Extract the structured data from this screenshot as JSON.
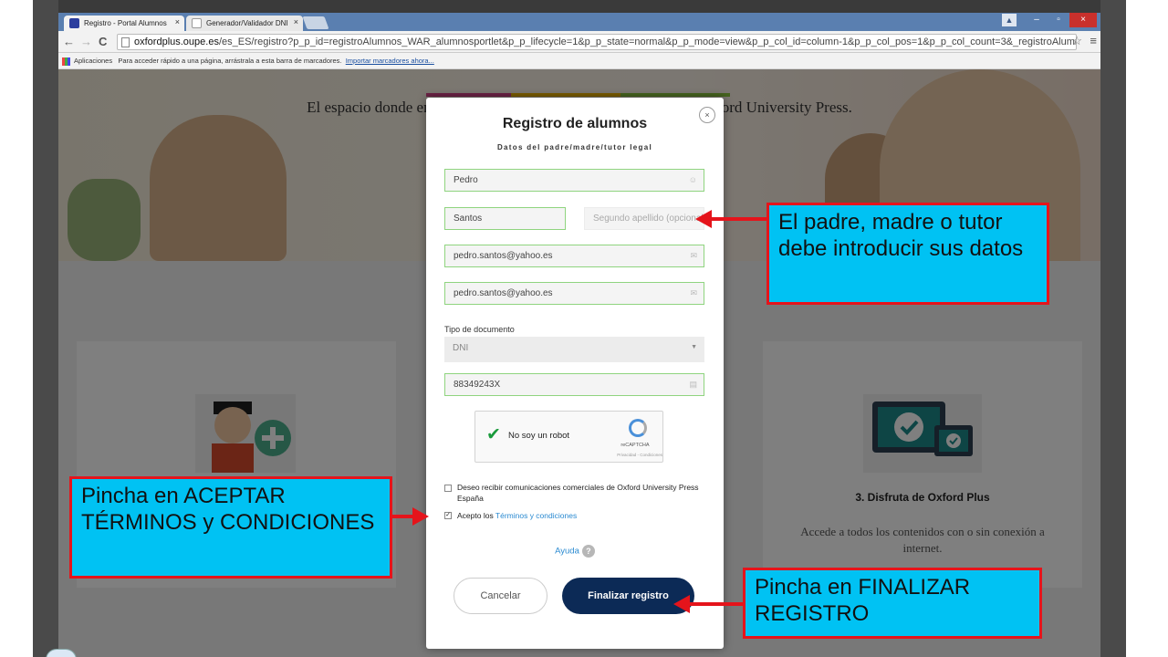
{
  "browser": {
    "tabs": [
      {
        "label": "Registro - Portal Alumnos",
        "close": "×"
      },
      {
        "label": "Generador/Validador DNI",
        "close": "×"
      }
    ],
    "window_controls": {
      "user": "▲",
      "minimize": "–",
      "maximize": "▫",
      "close": "×"
    },
    "nav": {
      "back": "←",
      "forward": "→",
      "reload": "C"
    },
    "url_host": "oxfordplus.oupe.es",
    "url_path": "/es_ES/registro?p_p_id=registroAlumnos_WAR_alumnosportlet&p_p_lifecycle=1&p_p_state=normal&p_p_mode=view&p_p_col_id=column-1&p_p_col_pos=1&p_p_col_count=3&_registroAlumnc",
    "star": "☆",
    "menu": "≡",
    "bookmarks": {
      "apps": "Aplicaciones",
      "hint": "Para acceder rápido a una página, arrástrala a esta barra de marcadores.",
      "import_link": "Importar marcadores ahora..."
    }
  },
  "page": {
    "hero_title": "El espacio donde encontrarás todos los contenidos digitales de Oxford University Press.",
    "card3_title": "3. Disfruta de Oxford Plus",
    "card3_desc": "Accede a todos los contenidos con o sin conexión a internet."
  },
  "modal": {
    "close": "×",
    "title": "Registro de alumnos",
    "subtitle": "Datos del padre/madre/tutor legal",
    "fields": {
      "first_name": "Pedro",
      "last_name": "Santos",
      "second_last_name_placeholder": "Segundo apellido (opcional)",
      "email": "pedro.santos@yahoo.es",
      "email_confirm": "pedro.santos@yahoo.es",
      "doc_type_label": "Tipo de documento",
      "doc_type": "DNI",
      "doc_number": "88349243X"
    },
    "captcha": {
      "check": "✔",
      "label": "No soy un robot",
      "brand": "reCAPTCHA",
      "terms": "Privacidad - Condiciones"
    },
    "consent": {
      "marketing": "Deseo recibir comunicaciones comerciales de Oxford University Press España",
      "accept_prefix": "Acepto los ",
      "accept_link": "Términos y condiciones",
      "accept_checked": "✓"
    },
    "help": "Ayuda",
    "help_icon": "?",
    "cancel": "Cancelar",
    "finish": "Finalizar registro"
  },
  "callouts": {
    "parent": "El padre, madre o tutor debe introducir sus datos",
    "accept": "Pincha en ACEPTAR TÉRMINOS y CONDICIONES",
    "finish": "Pincha en FINALIZAR REGISTRO"
  },
  "colors": {
    "accent_blue": "#00c2f3",
    "callout_border": "#e5141b",
    "finish_button": "#0c2a56",
    "field_valid": "#8fd47f"
  }
}
